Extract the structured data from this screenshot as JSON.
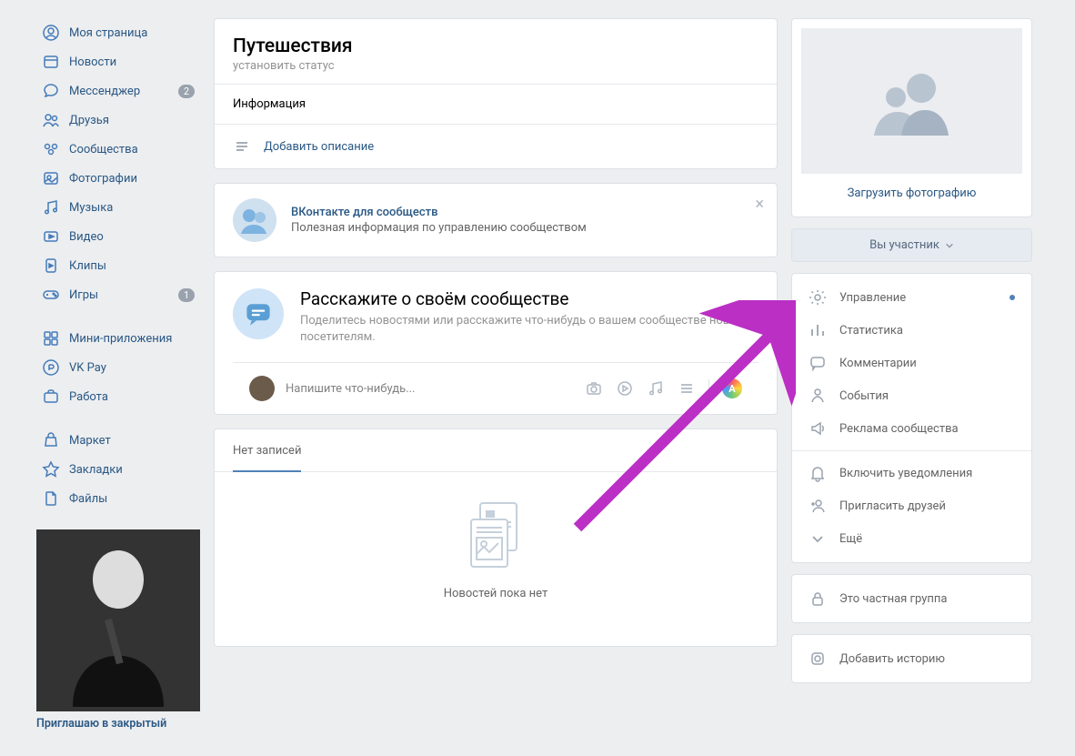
{
  "sidebar": {
    "items": [
      {
        "label": "Моя страница",
        "icon": "profile"
      },
      {
        "label": "Новости",
        "icon": "news"
      },
      {
        "label": "Мессенджер",
        "icon": "messenger",
        "badge": "2"
      },
      {
        "label": "Друзья",
        "icon": "friends"
      },
      {
        "label": "Сообщества",
        "icon": "groups"
      },
      {
        "label": "Фотографии",
        "icon": "photos"
      },
      {
        "label": "Музыка",
        "icon": "music"
      },
      {
        "label": "Видео",
        "icon": "video"
      },
      {
        "label": "Клипы",
        "icon": "clips"
      },
      {
        "label": "Игры",
        "icon": "games",
        "badge": "1"
      }
    ],
    "items2": [
      {
        "label": "Мини-приложения",
        "icon": "apps"
      },
      {
        "label": "VK Pay",
        "icon": "pay"
      },
      {
        "label": "Работа",
        "icon": "work"
      }
    ],
    "items3": [
      {
        "label": "Маркет",
        "icon": "market"
      },
      {
        "label": "Закладки",
        "icon": "bookmarks"
      },
      {
        "label": "Файлы",
        "icon": "files"
      }
    ],
    "profile_caption": "Приглашаю в закрытый"
  },
  "main": {
    "group_title": "Путешествия",
    "set_status": "установить статус",
    "info_label": "Информация",
    "add_description": "Добавить описание",
    "vk_info_title": "ВКонтакте для сообществ",
    "vk_info_sub": "Полезная информация по управлению сообществом",
    "tell_title": "Расскажите о своём сообществе",
    "tell_sub": "Поделитесь новостями или расскажите что-нибудь о вашем сообществе новым посетителям.",
    "post_placeholder": "Напишите что-нибудь...",
    "no_posts_tab": "Нет записей",
    "no_news": "Новостей пока нет"
  },
  "right": {
    "upload_photo": "Загрузить фотографию",
    "member_btn": "Вы участник",
    "menu": [
      {
        "label": "Управление",
        "icon": "gear",
        "dot": true
      },
      {
        "label": "Статистика",
        "icon": "stats"
      },
      {
        "label": "Комментарии",
        "icon": "comments"
      },
      {
        "label": "События",
        "icon": "events"
      },
      {
        "label": "Реклама сообщества",
        "icon": "ads"
      }
    ],
    "menu2": [
      {
        "label": "Включить уведомления",
        "icon": "bell"
      },
      {
        "label": "Пригласить друзей",
        "icon": "invite"
      },
      {
        "label": "Ещё",
        "icon": "chevron-down"
      }
    ],
    "private_group": "Это частная группа",
    "add_story": "Добавить историю"
  }
}
